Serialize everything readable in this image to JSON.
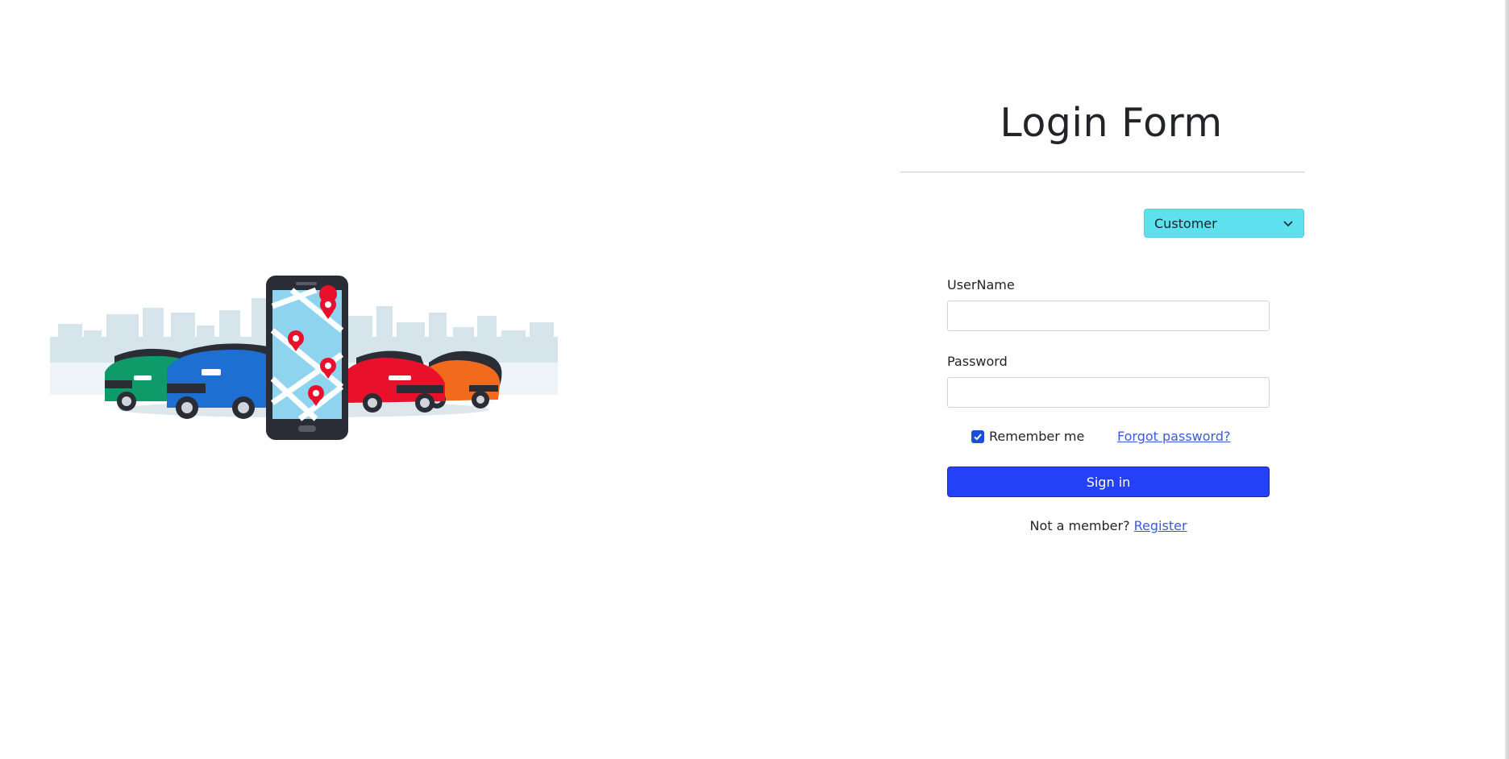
{
  "login": {
    "title": "Login Form",
    "role_select": {
      "selected": "Customer",
      "icon": "chevron-down-icon"
    },
    "username": {
      "label": "UserName",
      "value": "",
      "placeholder": ""
    },
    "password": {
      "label": "Password",
      "value": "",
      "placeholder": ""
    },
    "remember": {
      "label": "Remember me",
      "checked": true
    },
    "forgot_label": "Forgot password?",
    "signin_label": "Sign in",
    "footer": {
      "prompt": "Not a member? ",
      "register_label": "Register"
    }
  },
  "colors": {
    "select_bg": "#5ee0ef",
    "primary": "#2541f7",
    "link": "#3b5bdb",
    "checkbox": "#1d4ed8"
  }
}
